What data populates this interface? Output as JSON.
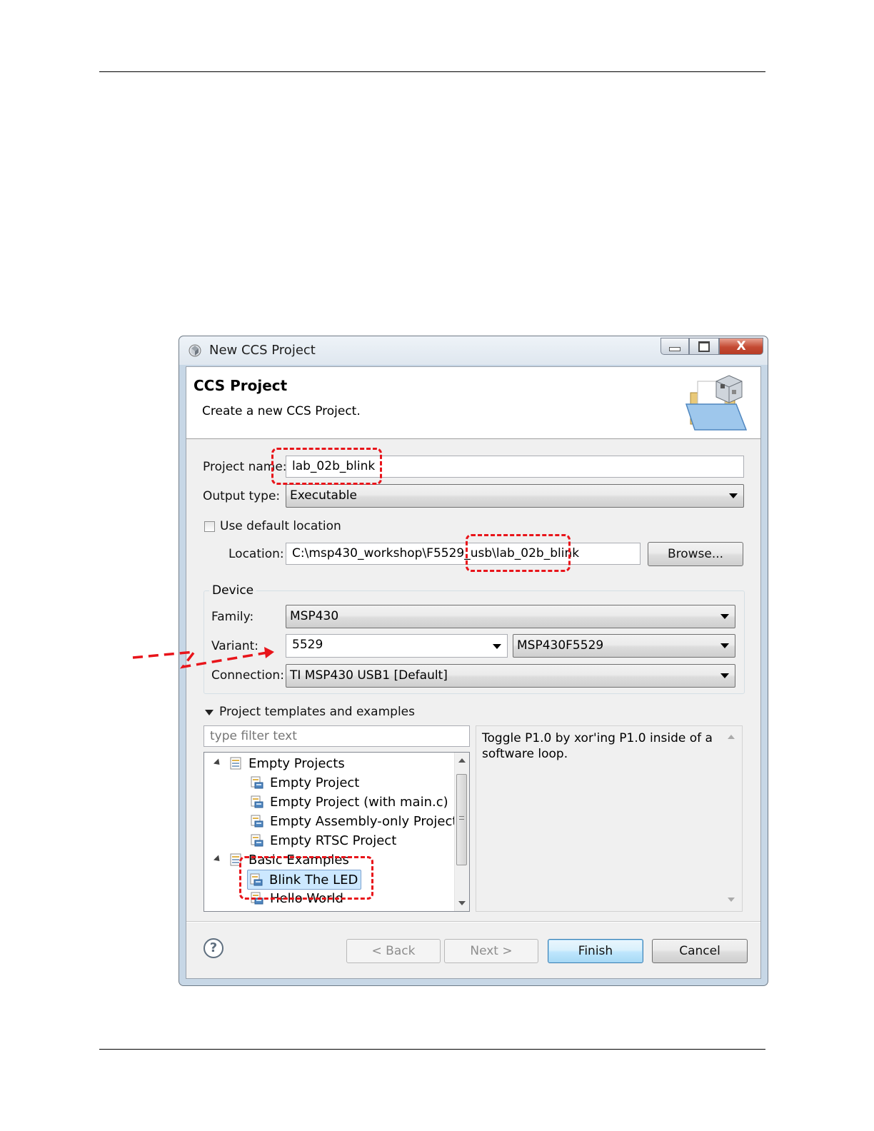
{
  "window": {
    "title": "New CCS Project",
    "minimize_glyph": "▭",
    "maximize_glyph": "▣",
    "close_glyph": "X"
  },
  "banner": {
    "title": "CCS Project",
    "description": "Create a new CCS Project."
  },
  "form": {
    "project_name_label": "Project name:",
    "project_name_value": "lab_02b_blink",
    "output_type_label": "Output type:",
    "output_type_value": "Executable",
    "use_default_location_label": "Use default location",
    "use_default_location_checked": false,
    "location_label": "Location:",
    "location_value": "C:\\msp430_workshop\\F5529_usb\\lab_02b_blink",
    "browse_label": "Browse..."
  },
  "device": {
    "group_title": "Device",
    "family_label": "Family:",
    "family_value": "MSP430",
    "variant_label": "Variant:",
    "variant_filter_value": "5529",
    "variant_value": "MSP430F5529",
    "connection_label": "Connection:",
    "connection_value": "TI MSP430 USB1 [Default]"
  },
  "templates": {
    "section_label": "Project templates and examples",
    "filter_placeholder": "type filter text",
    "tree": [
      {
        "label": "Empty Projects",
        "level": 0,
        "expanded": true
      },
      {
        "label": "Empty Project",
        "level": 1
      },
      {
        "label": "Empty Project (with main.c)",
        "level": 1
      },
      {
        "label": "Empty Assembly-only Project",
        "level": 1
      },
      {
        "label": "Empty RTSC Project",
        "level": 1
      },
      {
        "label": "Basic Examples",
        "level": 0,
        "expanded": true
      },
      {
        "label": "Blink The LED",
        "level": 1,
        "selected": true
      },
      {
        "label": "Hello World",
        "level": 1
      }
    ],
    "description": "Toggle P1.0 by xor'ing P1.0 inside of a software loop."
  },
  "buttons": {
    "help_glyph": "?",
    "back": "< Back",
    "next": "Next >",
    "finish": "Finish",
    "cancel": "Cancel"
  },
  "colors": {
    "annotation": "#e8141a",
    "selection": "#cce8ff"
  }
}
